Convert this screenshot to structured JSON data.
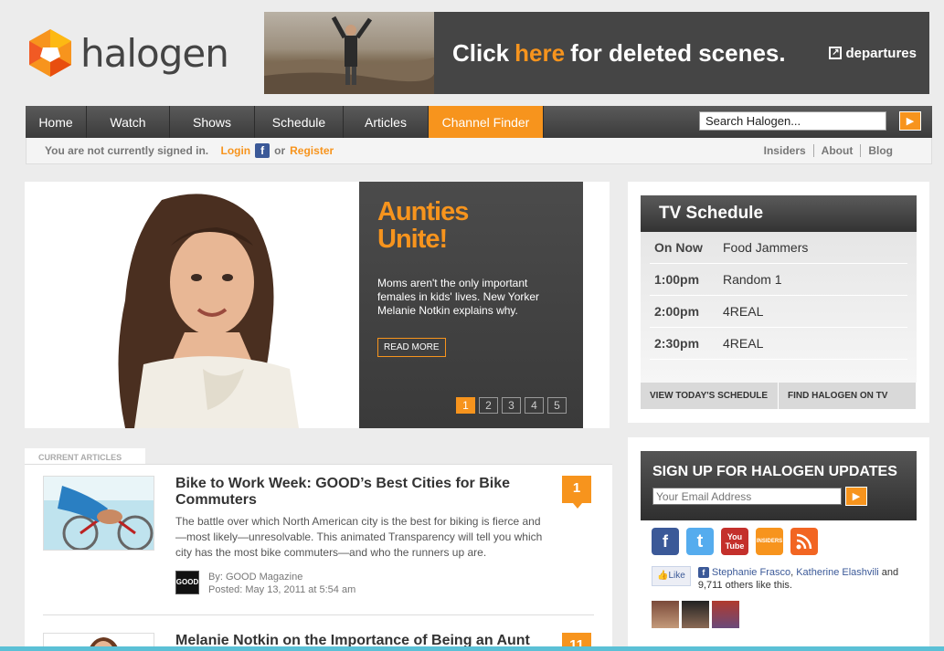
{
  "brand": {
    "logo_text": "halogen"
  },
  "banner": {
    "text_before": "Click",
    "text_highlight": "here",
    "text_after": "for deleted scenes.",
    "brand": "departures",
    "brand_icon": "arrow-box-icon"
  },
  "nav": {
    "items": [
      "Home",
      "Watch",
      "Shows",
      "Schedule",
      "Articles",
      "Channel Finder"
    ],
    "active": "Channel Finder",
    "search_value": "Search Halogen..."
  },
  "account": {
    "status": "You are not currently signed in.",
    "login": "Login",
    "or": "or",
    "register": "Register",
    "links": [
      "Insiders",
      "About",
      "Blog"
    ]
  },
  "hero": {
    "title_line1": "Aunties",
    "title_line2": "Unite!",
    "description": "Moms aren't the only important females in kids' lives. New Yorker Melanie Notkin explains why.",
    "cta": "READ MORE",
    "pages": [
      "1",
      "2",
      "3",
      "4",
      "5"
    ],
    "active_page": "1"
  },
  "tv_schedule": {
    "title": "TV Schedule",
    "rows": [
      {
        "time": "On Now",
        "show": "Food Jammers"
      },
      {
        "time": "1:00pm",
        "show": "Random 1"
      },
      {
        "time": "2:00pm",
        "show": "4REAL"
      },
      {
        "time": "2:30pm",
        "show": "4REAL"
      }
    ],
    "view_today": "VIEW TODAY'S SCHEDULE",
    "find_halogen": "FIND HALOGEN ON TV"
  },
  "articles": {
    "tab_label": "CURRENT ARTICLES",
    "items": [
      {
        "title": "Bike to Work Week: GOOD’s Best Cities for Bike Commuters",
        "description": "The battle over which North American city is the best for biking is fierce and—most likely—unresolvable. This animated Transparency will tell you which city has the most bike commuters—and who the runners up are.",
        "by": "By: GOOD Magazine",
        "posted": "Posted: May 13, 2011 at 5:54 am",
        "source_logo": "GOOD",
        "comments": "1"
      },
      {
        "title": "Melanie Notkin on the Importance of Being an Aunt",
        "comments": "11"
      }
    ]
  },
  "signup": {
    "title": "SIGN UP FOR HALOGEN UPDATES",
    "email_placeholder": "Your Email Address",
    "social": [
      "facebook-icon",
      "twitter-icon",
      "youtube-icon",
      "insiders-icon",
      "rss-icon"
    ],
    "like_label": "Like",
    "friend1": "Stephanie Frasco",
    "friend2": "Katherine Elashvili",
    "and": "and",
    "others": "9,711 others like this."
  },
  "colors": {
    "accent": "#f7941d",
    "nav_bg": "#3b3b3b",
    "page_bg": "#ececec",
    "facebook": "#3b5998"
  }
}
